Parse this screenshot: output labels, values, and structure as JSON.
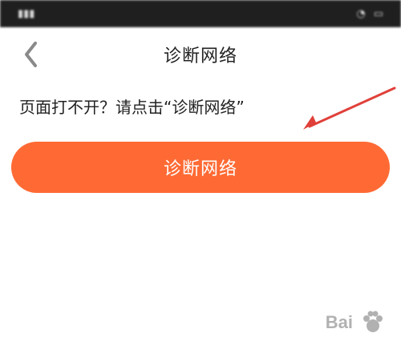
{
  "colors": {
    "accent": "#ff6a34",
    "status_bar_bg": "#1f1f1f",
    "annotation": "#e0403a"
  },
  "status_bar": {
    "left": "",
    "right": ""
  },
  "header": {
    "title": "诊断网络"
  },
  "instruction": "页面打不开？请点击“诊断网络”",
  "button": {
    "label": "诊断网络"
  },
  "details": {
    "lines": [
      "",
      "",
      "",
      "",
      "",
      ""
    ]
  },
  "watermark": {
    "text": "Bai"
  },
  "icons": {
    "back": "chevron-left-icon",
    "arrow": "arrow-icon",
    "watermark": "baidu-paw-icon"
  }
}
